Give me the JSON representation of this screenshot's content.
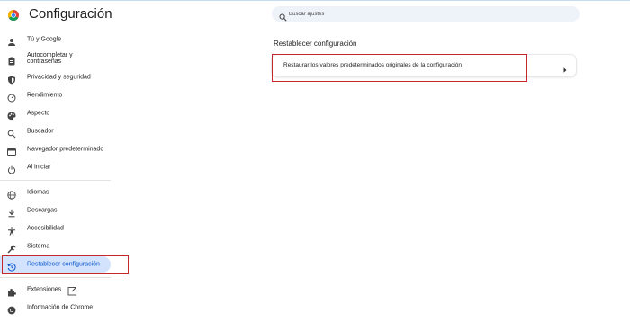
{
  "app": {
    "title": "Configuración"
  },
  "search": {
    "placeholder": "Buscar ajustes"
  },
  "sidebar": {
    "items": [
      {
        "id": "you-google",
        "label": "Tú y Google",
        "icon": "person-icon"
      },
      {
        "id": "autofill",
        "label": "Autocompletar y contraseñas",
        "icon": "clipboard-icon"
      },
      {
        "id": "privacy",
        "label": "Privacidad y seguridad",
        "icon": "shield-icon"
      },
      {
        "id": "performance",
        "label": "Rendimiento",
        "icon": "speedometer-icon"
      },
      {
        "id": "appearance",
        "label": "Aspecto",
        "icon": "palette-icon"
      },
      {
        "id": "search-engine",
        "label": "Buscador",
        "icon": "search-icon"
      },
      {
        "id": "default-browser",
        "label": "Navegador predeterminado",
        "icon": "browser-window-icon"
      },
      {
        "id": "on-startup",
        "label": "Al iniciar",
        "icon": "power-icon"
      },
      {
        "id": "languages",
        "label": "Idiomas",
        "icon": "globe-icon"
      },
      {
        "id": "downloads",
        "label": "Descargas",
        "icon": "download-icon"
      },
      {
        "id": "accessibility",
        "label": "Accesibilidad",
        "icon": "accessibility-icon"
      },
      {
        "id": "system",
        "label": "Sistema",
        "icon": "wrench-icon"
      },
      {
        "id": "reset",
        "label": "Restablecer configuración",
        "icon": "history-icon",
        "active": true
      },
      {
        "id": "extensions",
        "label": "Extensiones",
        "icon": "puzzle-icon"
      },
      {
        "id": "about",
        "label": "Información de Chrome",
        "icon": "chrome-icon"
      }
    ]
  },
  "main": {
    "section_title": "Restablecer configuración",
    "reset_row_label": "Restaurar los valores predeterminados originales de la configuración"
  },
  "colors": {
    "accent": "#0b57d0",
    "active_bg": "#d3e3fd",
    "highlight": "#c62828",
    "search_bg": "#eef2f9"
  }
}
